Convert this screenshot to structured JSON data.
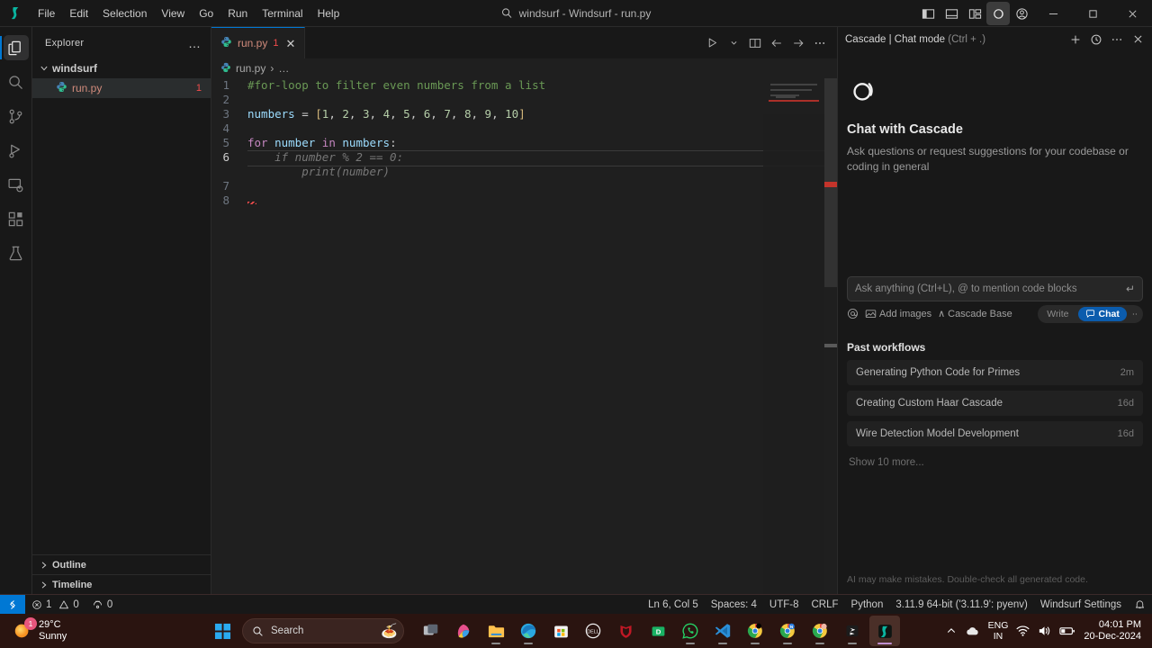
{
  "titlebar": {
    "window_title": "windsurf - Windsurf - run.py",
    "menus": [
      "File",
      "Edit",
      "Selection",
      "View",
      "Go",
      "Run",
      "Terminal",
      "Help"
    ],
    "icons": [
      "toggle-primary-sidebar-icon",
      "toggle-panel-icon",
      "customize-layout-icon",
      "cascade-icon",
      "account-icon"
    ],
    "window_controls": [
      "minimize",
      "maximize",
      "close"
    ]
  },
  "activitybar": {
    "items": [
      {
        "name": "explorer",
        "active": true
      },
      {
        "name": "search",
        "active": false
      },
      {
        "name": "source-control",
        "active": false
      },
      {
        "name": "run-and-debug",
        "active": false
      },
      {
        "name": "remote-explorer",
        "active": false
      },
      {
        "name": "extensions",
        "active": false
      },
      {
        "name": "testing",
        "active": false
      }
    ]
  },
  "sidebar": {
    "title": "Explorer",
    "more_label": "…",
    "root_folder": "windsurf",
    "files": [
      {
        "name": "run.py",
        "problems": "1"
      }
    ],
    "sections": [
      "Outline",
      "Timeline"
    ]
  },
  "editor": {
    "tab": {
      "label": "run.py",
      "problems": "1",
      "close": "✕"
    },
    "breadcrumb": [
      "run.py",
      "…"
    ],
    "actions": [
      "run-icon",
      "run-dropdown-icon",
      "split-editor-icon",
      "back-icon",
      "forward-icon",
      "more-actions-icon"
    ],
    "cursor_line": 6,
    "lines": [
      {
        "num": "1",
        "type": "code",
        "tokens": [
          {
            "t": "#for-loop to filter even numbers from a list",
            "c": "c-comment"
          }
        ]
      },
      {
        "num": "2",
        "type": "code",
        "tokens": []
      },
      {
        "num": "3",
        "type": "code",
        "tokens": [
          {
            "t": "numbers",
            "c": "c-var"
          },
          {
            "t": " = ",
            "c": "c-op"
          },
          {
            "t": "[",
            "c": "c-brk"
          },
          {
            "t": "1",
            "c": "c-num"
          },
          {
            "t": ", ",
            "c": "c-op"
          },
          {
            "t": "2",
            "c": "c-num"
          },
          {
            "t": ", ",
            "c": "c-op"
          },
          {
            "t": "3",
            "c": "c-num"
          },
          {
            "t": ", ",
            "c": "c-op"
          },
          {
            "t": "4",
            "c": "c-num"
          },
          {
            "t": ", ",
            "c": "c-op"
          },
          {
            "t": "5",
            "c": "c-num"
          },
          {
            "t": ", ",
            "c": "c-op"
          },
          {
            "t": "6",
            "c": "c-num"
          },
          {
            "t": ", ",
            "c": "c-op"
          },
          {
            "t": "7",
            "c": "c-num"
          },
          {
            "t": ", ",
            "c": "c-op"
          },
          {
            "t": "8",
            "c": "c-num"
          },
          {
            "t": ", ",
            "c": "c-op"
          },
          {
            "t": "9",
            "c": "c-num"
          },
          {
            "t": ", ",
            "c": "c-op"
          },
          {
            "t": "10",
            "c": "c-num"
          },
          {
            "t": "]",
            "c": "c-brk"
          }
        ]
      },
      {
        "num": "4",
        "type": "code",
        "tokens": []
      },
      {
        "num": "5",
        "type": "code",
        "tokens": [
          {
            "t": "for",
            "c": "c-kw"
          },
          {
            "t": " ",
            "c": "c-op"
          },
          {
            "t": "number",
            "c": "c-var"
          },
          {
            "t": " ",
            "c": "c-op"
          },
          {
            "t": "in",
            "c": "c-kw"
          },
          {
            "t": " ",
            "c": "c-op"
          },
          {
            "t": "numbers",
            "c": "c-var"
          },
          {
            "t": ":",
            "c": "c-op"
          }
        ]
      },
      {
        "num": "6",
        "type": "ghost",
        "active": true,
        "tokens": [
          {
            "t": "    if number % 2 == 0:",
            "c": "ghost"
          }
        ]
      },
      {
        "num": "",
        "type": "ghost",
        "tokens": [
          {
            "t": "        print(number)",
            "c": "ghost"
          }
        ]
      },
      {
        "num": "7",
        "type": "code",
        "tokens": []
      },
      {
        "num": "8",
        "type": "error",
        "tokens": []
      }
    ]
  },
  "cascade": {
    "header_title": "Cascade | Chat mode",
    "header_shortcut": "(Ctrl + .)",
    "header_icons": [
      "new-chat-icon",
      "history-icon",
      "more-icon",
      "close-icon"
    ],
    "welcome_heading": "Chat with Cascade",
    "welcome_text": "Ask questions or request suggestions for your codebase or coding in general",
    "input_placeholder": "Ask anything (Ctrl+L), @ to mention code blocks",
    "send_icon": "↵",
    "tools": {
      "mention_icon": "@",
      "add_images_label": "Add images",
      "model_label": "Cascade Base",
      "model_chevron": "∧"
    },
    "mode_toggle": {
      "write_label": "Write",
      "chat_label": "Chat",
      "active": "Chat",
      "more": "∙∙"
    },
    "workflows_title": "Past workflows",
    "workflows": [
      {
        "title": "Generating Python Code for Primes",
        "time": "2m"
      },
      {
        "title": "Creating Custom Haar Cascade",
        "time": "16d"
      },
      {
        "title": "Wire Detection Model Development",
        "time": "16d"
      }
    ],
    "show_more": "Show 10 more...",
    "disclaimer": "AI may make mistakes. Double-check all generated code.",
    "accent_color": "#0b5cad"
  },
  "statusbar": {
    "remote_icon": "remote-window-icon",
    "errors": "1",
    "warnings": "0",
    "ports": "0",
    "cursor_position": "Ln 6, Col 5",
    "indentation": "Spaces: 4",
    "encoding": "UTF-8",
    "eol": "CRLF",
    "language": "Python",
    "interpreter": "3.11.9 64-bit ('3.11.9': pyenv)",
    "settings_label": "Windsurf Settings",
    "bell_icon": "notifications-bell-icon"
  },
  "taskbar": {
    "weather": {
      "temperature": "29°C",
      "condition": "Sunny",
      "badge": "1"
    },
    "search_placeholder": "Search",
    "apps": [
      {
        "name": "task-view",
        "running": false
      },
      {
        "name": "copilot",
        "running": false
      },
      {
        "name": "file-explorer",
        "running": true
      },
      {
        "name": "microsoft-edge",
        "running": true
      },
      {
        "name": "microsoft-store",
        "running": false
      },
      {
        "name": "dell",
        "running": false
      },
      {
        "name": "mcafee",
        "running": false
      },
      {
        "name": "green-app",
        "running": false
      },
      {
        "name": "whatsapp",
        "running": true
      },
      {
        "name": "vs-code",
        "running": true
      },
      {
        "name": "chrome",
        "running": true
      },
      {
        "name": "chrome-notion",
        "running": true
      },
      {
        "name": "chrome-secondary",
        "running": true
      },
      {
        "name": "dark-app",
        "running": true
      },
      {
        "name": "windsurf",
        "running": true,
        "active": true
      }
    ],
    "tray": {
      "chevron": "∧",
      "cloud_icon": "cloud-icon",
      "language": "ENG",
      "region": "IN",
      "wifi_icon": "wifi-icon",
      "volume_icon": "volume-icon",
      "battery_icon": "battery-icon",
      "time": "04:01 PM",
      "date": "20-Dec-2024"
    }
  }
}
